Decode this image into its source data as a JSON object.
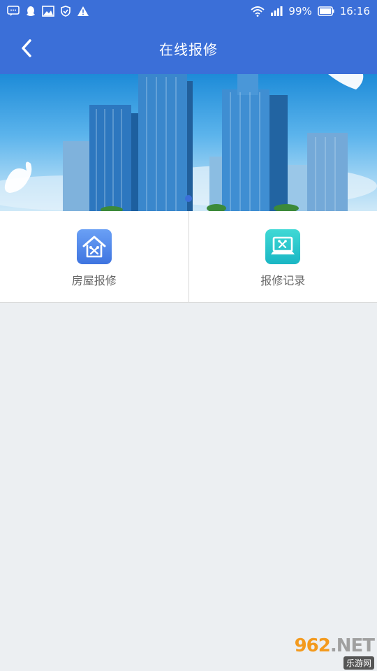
{
  "status_bar": {
    "battery": "99%",
    "time": "16:16"
  },
  "header": {
    "title": "在线报修"
  },
  "banner": {
    "active_index": 0,
    "slide_count": 1
  },
  "menu": {
    "items": [
      {
        "label": "房屋报修",
        "icon": "house-repair-icon"
      },
      {
        "label": "报修记录",
        "icon": "repair-record-icon"
      }
    ]
  },
  "watermark": {
    "logo_number": "962",
    "logo_suffix": ".NET",
    "sub": "乐游网"
  },
  "colors": {
    "primary": "#3b6fd8",
    "background": "#eceff2",
    "house_icon": "#4a80e8",
    "record_icon": "#22c3cc"
  }
}
